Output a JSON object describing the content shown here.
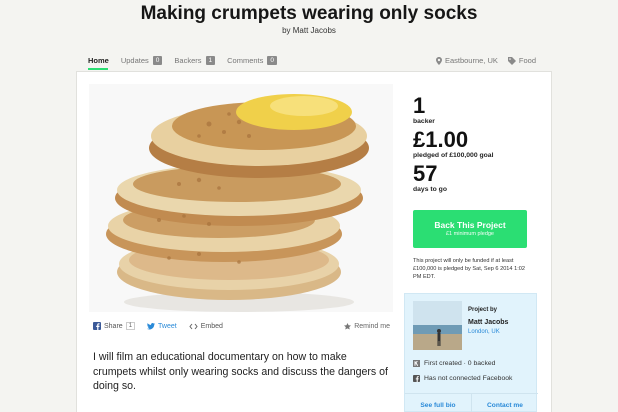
{
  "project": {
    "title": "Making crumpets wearing only socks",
    "by_prefix": "by",
    "author": "Matt Jacobs",
    "blurb": "I will film an educational documentary on how to make crumpets whilst only wearing socks and discuss the dangers of doing so."
  },
  "tabs": [
    {
      "label": "Home",
      "active": true
    },
    {
      "label": "Updates",
      "count": "0"
    },
    {
      "label": "Backers",
      "count": "1"
    },
    {
      "label": "Comments",
      "count": "0"
    }
  ],
  "meta": {
    "location": "Eastbourne, UK",
    "category": "Food"
  },
  "share": {
    "facebook_label": "Share",
    "facebook_count": "1",
    "tweet_label": "Tweet",
    "embed_label": "Embed",
    "remind_label": "Remind me"
  },
  "stats": {
    "backers_value": "1",
    "backers_label": "backer",
    "pledged_value": "£1.00",
    "pledged_label": "pledged of £100,000 goal",
    "days_value": "57",
    "days_label": "days to go"
  },
  "back_button": {
    "label": "Back This Project",
    "sub": "£1 minimum pledge"
  },
  "funding_note": "This project will only be funded if at least £100,000 is pledged by Sat, Sep 6 2014 1:02 PM EDT.",
  "creator": {
    "heading": "Project by",
    "name": "Matt Jacobs",
    "location": "London, UK",
    "first_created": "First created · 0 backed",
    "facebook": "Has not connected Facebook",
    "full_bio": "See full bio",
    "contact": "Contact me"
  },
  "colors": {
    "accent_green": "#2bde73",
    "link_blue": "#2a8ad8",
    "creator_bg": "#e1f3fc"
  }
}
